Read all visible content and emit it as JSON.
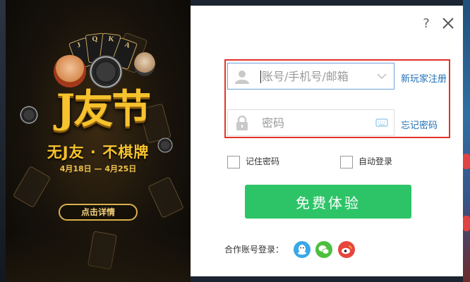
{
  "banner": {
    "logo_text": "J友节",
    "slogan": "无J友 · 不棋牌",
    "dates": "4月18日 — 4月25日",
    "detail_button": "点击详情",
    "card_labels": [
      "J",
      "Q",
      "K",
      "A"
    ]
  },
  "window": {
    "help_icon": "question-mark-icon",
    "close_icon": "close-icon"
  },
  "login": {
    "account_placeholder": "账号/手机号/邮箱",
    "password_placeholder": "密码",
    "register_link": "新玩家注册",
    "forgot_link": "忘记密码",
    "remember_label": "记住密码",
    "autologin_label": "自动登录",
    "submit_label": "免费体验",
    "partner_label": "合作账号登录：",
    "partners": [
      "qq-icon",
      "wechat-icon",
      "weibo-icon"
    ]
  },
  "colors": {
    "accent_green": "#2dc468",
    "link_blue": "#1f6fb5",
    "highlight_red": "#e3322b",
    "banner_gold": "#f6c22d"
  }
}
